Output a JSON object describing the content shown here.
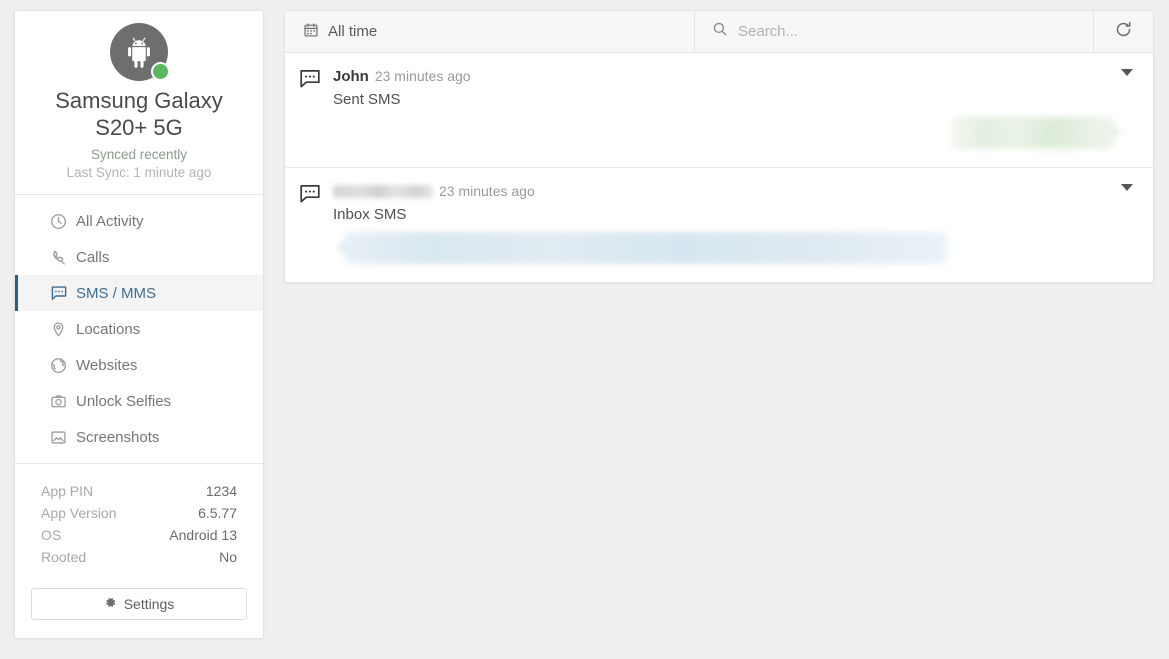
{
  "sidebar": {
    "device": {
      "avatar_icon": "android-robot-icon",
      "status_dot_color": "#5cb85c",
      "name": "Samsung Galaxy S20+ 5G",
      "sync_status": "Synced recently",
      "last_sync": "Last Sync: 1 minute ago"
    },
    "nav_items": [
      {
        "label": "All Activity",
        "icon": "clock-icon",
        "active": false
      },
      {
        "label": "Calls",
        "icon": "phone-icon",
        "active": false
      },
      {
        "label": "SMS / MMS",
        "icon": "speech-bubble-icon",
        "active": true
      },
      {
        "label": "Locations",
        "icon": "map-pin-icon",
        "active": false
      },
      {
        "label": "Websites",
        "icon": "globe-icon",
        "active": false
      },
      {
        "label": "Unlock Selfies",
        "icon": "camera-icon",
        "active": false
      },
      {
        "label": "Screenshots",
        "icon": "image-icon",
        "active": false
      }
    ],
    "info_rows": [
      {
        "key": "App PIN",
        "value": "1234"
      },
      {
        "key": "App Version",
        "value": "6.5.77"
      },
      {
        "key": "OS",
        "value": "Android 13"
      },
      {
        "key": "Rooted",
        "value": "No"
      }
    ],
    "settings_button": {
      "label": "Settings",
      "icon": "gear-icon"
    }
  },
  "toolbar": {
    "date_filter": {
      "label": "All time",
      "icon": "calendar-icon"
    },
    "search": {
      "value": "",
      "placeholder": "Search...",
      "icon": "search-icon"
    },
    "refresh": {
      "icon": "refresh-icon",
      "label": ""
    }
  },
  "messages": [
    {
      "icon": "speech-bubble-icon",
      "sender": "John",
      "sender_redacted": false,
      "time": "23 minutes ago",
      "type": "Sent SMS",
      "direction": "out",
      "bubble_color": "#e3efe0",
      "caret_icon": "chevron-down-icon"
    },
    {
      "icon": "speech-bubble-icon",
      "sender": "",
      "sender_redacted": true,
      "time": "23 minutes ago",
      "type": "Inbox SMS",
      "direction": "in",
      "bubble_color": "#d9e7f0",
      "caret_icon": "chevron-down-icon"
    }
  ],
  "theme": {
    "page_bg": "#efefef",
    "card_bg": "#ffffff",
    "accent": "#2f5d80",
    "active_text": "#3d6f95"
  }
}
